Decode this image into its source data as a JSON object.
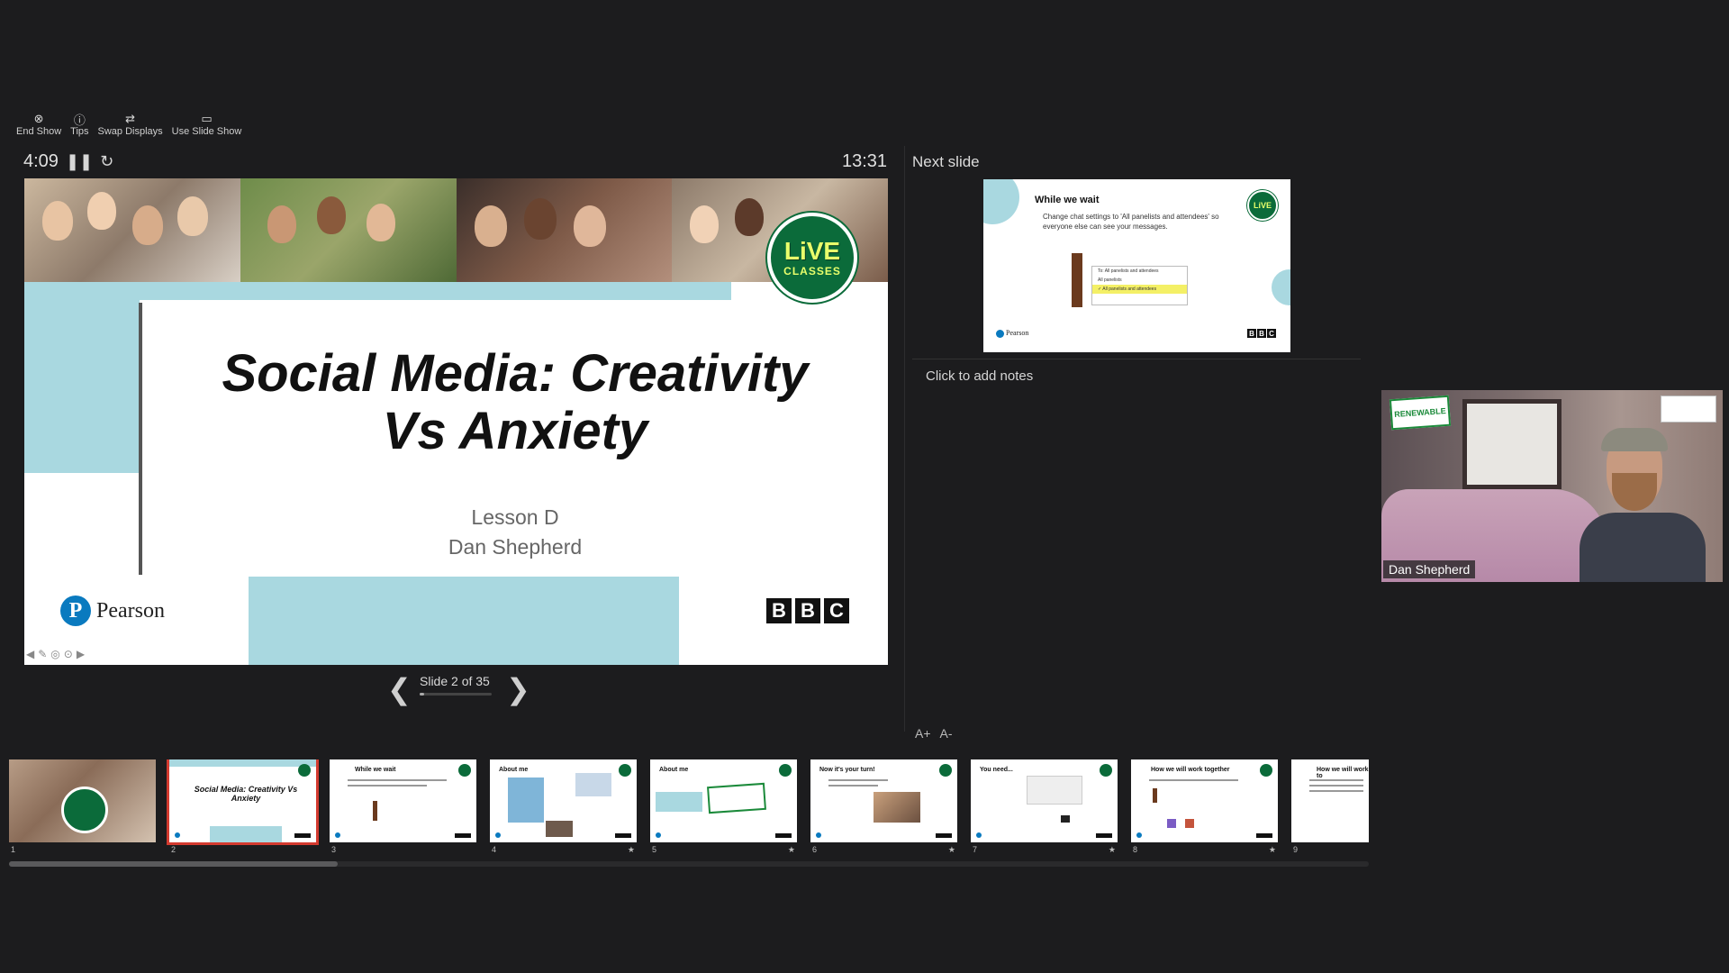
{
  "toolbar": {
    "end_show": "End Show",
    "tips": "Tips",
    "swap_displays": "Swap Displays",
    "use_slide_show": "Use Slide Show"
  },
  "timer": {
    "elapsed": "4:09",
    "clock": "13:31"
  },
  "current_slide": {
    "title_line1": "Social Media: Creativity",
    "title_line2": "Vs Anxiety",
    "subtitle_line1": "Lesson D",
    "subtitle_line2": "Dan Shepherd",
    "badge_line1": "LiVE",
    "badge_line2": "CLASSES",
    "pearson": "Pearson",
    "bbc": [
      "B",
      "B",
      "C"
    ]
  },
  "navigation": {
    "counter": "Slide 2 of 35",
    "progress": 0.057
  },
  "next_slide": {
    "label": "Next slide",
    "title": "While we wait",
    "text": "Change chat settings to 'All panelists and attendees' so everyone else can see your messages.",
    "popup_to": "To:  All panelists and attendees",
    "option1": "All panelists",
    "option2": "✓ All panelists and attendees",
    "pearson": "Pearson",
    "bbc": [
      "B",
      "B",
      "C"
    ]
  },
  "notes": {
    "placeholder": "Click to add notes"
  },
  "video": {
    "participant": "Dan Shepherd",
    "sign": "RENEWABLE"
  },
  "font_controls": {
    "increase": "A+",
    "decrease": "A-"
  },
  "thumbnails": [
    {
      "num": "1",
      "title": "",
      "star": ""
    },
    {
      "num": "2",
      "title": "Social Media: Creativity Vs Anxiety",
      "star": ""
    },
    {
      "num": "3",
      "title": "While we wait",
      "star": ""
    },
    {
      "num": "4",
      "title": "About me",
      "star": "★"
    },
    {
      "num": "5",
      "title": "About me",
      "star": "★"
    },
    {
      "num": "6",
      "title": "Now it's your turn!",
      "star": "★"
    },
    {
      "num": "7",
      "title": "You need...",
      "star": "★"
    },
    {
      "num": "8",
      "title": "How we will work together",
      "star": "★"
    },
    {
      "num": "9",
      "title": "How we will work to",
      "star": ""
    }
  ],
  "colors": {
    "accent_blue": "#a9d8e0",
    "selected_outline": "#d33a2f",
    "live_green": "#0b6b3a"
  }
}
